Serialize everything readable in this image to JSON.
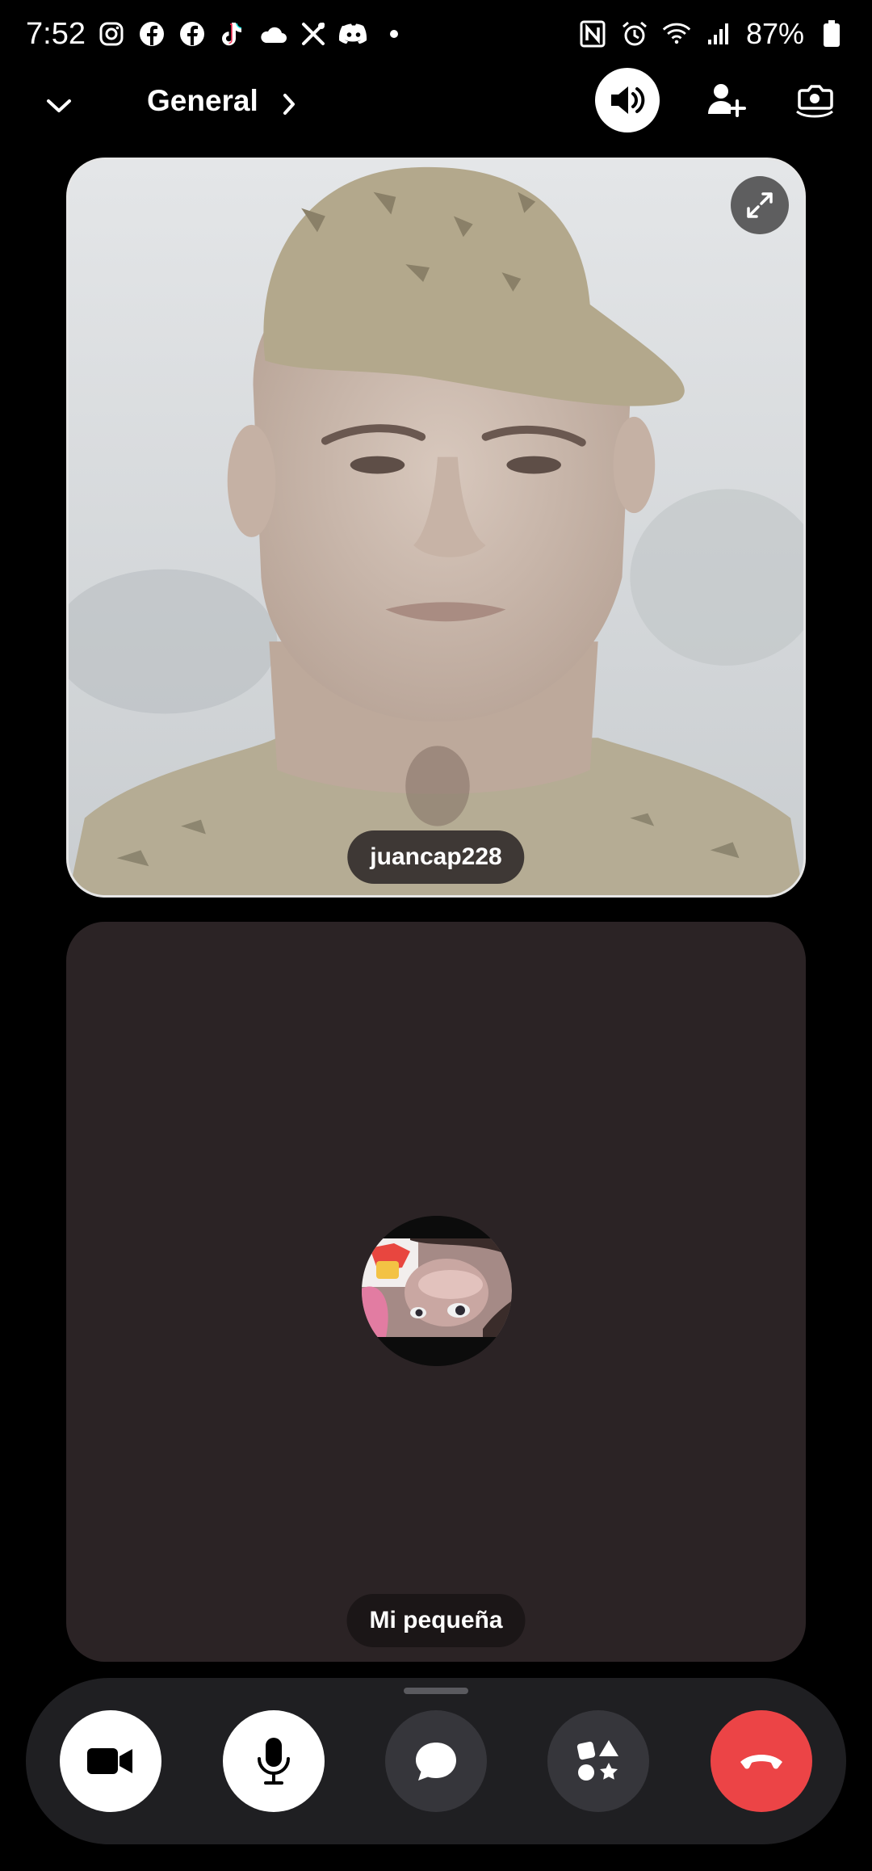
{
  "status_bar": {
    "time": "7:52",
    "battery_percent": "87%",
    "notification_icons": [
      "instagram-icon",
      "facebook-icon",
      "facebook-icon",
      "tiktok-icon",
      "cloud-icon",
      "tools-icon",
      "discord-icon",
      "dot-icon"
    ],
    "system_icons": [
      "nfc-icon",
      "alarm-icon",
      "wifi-icon",
      "signal-icon",
      "battery-icon"
    ]
  },
  "header": {
    "channel_name": "General"
  },
  "participants": [
    {
      "name": "juancap228",
      "video_on": true
    },
    {
      "name": "Mi pequeña",
      "video_on": false
    }
  ],
  "controls": {
    "buttons": [
      "camera-button",
      "microphone-button",
      "chat-button",
      "activities-button",
      "end-call-button"
    ]
  },
  "colors": {
    "end_call": "#ec4446",
    "voice_tile_bg": "#2b2325",
    "control_bar_bg": "#1f1f22"
  }
}
